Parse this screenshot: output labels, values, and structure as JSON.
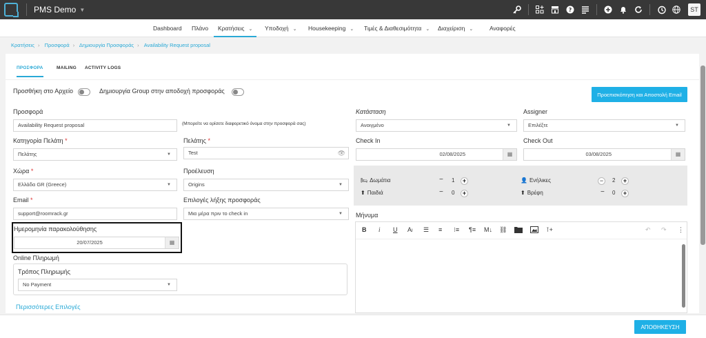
{
  "app": {
    "name": "PMS Demo",
    "user_initials": "ST"
  },
  "topbar": {
    "icons": [
      "key-icon",
      "grid-add-icon",
      "store-icon",
      "help-icon",
      "list-icon",
      "add-circle-icon",
      "bell-icon",
      "refresh-icon",
      "history-icon",
      "globe-icon"
    ]
  },
  "nav": {
    "items": [
      {
        "label": "Dashboard",
        "dropdown": false
      },
      {
        "label": "Πλάνο",
        "dropdown": false
      },
      {
        "label": "Κρατήσεις",
        "dropdown": true,
        "active": true
      },
      {
        "label": "Υποδοχή",
        "dropdown": true
      },
      {
        "label": "Housekeeping",
        "dropdown": true
      },
      {
        "label": "Τιμές & Διαθεσιμότητα",
        "dropdown": true
      },
      {
        "label": "Διαχείριση",
        "dropdown": true
      },
      {
        "label": "Αναφορές",
        "dropdown": false
      }
    ]
  },
  "breadcrumb": [
    "Κρατήσεις",
    "Προσφορά",
    "Δημιουργία Προσφοράς",
    "Availability Request proposal"
  ],
  "tabs": [
    "ΠΡΟΣΦΟΡΑ",
    "MAILING",
    "ACTIVITY LOGS"
  ],
  "toggles": {
    "archive_label": "Προσθήκη στο Αρχείο",
    "group_label": "Δημιουργία Group στην αποδοχή προσφοράς"
  },
  "preview_button": "Προεπισκόπηση και Αποστολή Email",
  "form": {
    "offer_label": "Προσφορά",
    "offer_value": "Availability Request proposal",
    "offer_hint": "(Μπορείτε να ορίσετε διαφορετικό όνομα στην προσφορά σας)",
    "client_category_label": "Κατηγορία Πελάτη",
    "client_category_value": "Πελάτης",
    "client_label": "Πελάτης",
    "client_value": "Test",
    "country_label": "Χώρα",
    "country_value": "Ελλάδα GR (Greece)",
    "origin_label": "Προέλευση",
    "origin_value": "Origins",
    "email_label": "Email",
    "email_value": "support@roomrack.gr",
    "expiry_label": "Επιλογές λήξης προσφοράς",
    "expiry_value": "Μια μέρα πριν το check in",
    "followup_label": "Ημερομηνία παρακολούθησης",
    "followup_value": "20/07/2025",
    "online_payment_label": "Online Πληρωμή",
    "payment_method_label": "Τρόπος Πληρωμής",
    "payment_method_value": "No Payment",
    "more_options": "Περισσότερες Επιλογές",
    "status_label": "Κατάσταση",
    "status_value": "Ανοιγμένο",
    "assigner_label": "Assigner",
    "assigner_value": "Επιλέξτε",
    "checkin_label": "Check In",
    "checkin_value": "02/08/2025",
    "checkout_label": "Check Out",
    "checkout_value": "03/08/2025",
    "message_label": "Μήνυμα"
  },
  "guests": {
    "rooms_label": "Δωμάτια",
    "rooms_value": "1",
    "children_label": "Παιδιά",
    "children_value": "0",
    "adults_label": "Ενήλικες",
    "adults_value": "2",
    "infants_label": "Βρέφη",
    "infants_value": "0"
  },
  "editor_tools": [
    "bold-icon",
    "italic-icon",
    "underline-icon",
    "font-size-icon",
    "align-left-icon",
    "align-center-icon",
    "list-ordered-icon",
    "paragraph-icon",
    "markdown-icon",
    "link-icon",
    "folder-icon",
    "image-icon",
    "insert-icon",
    "undo-icon",
    "redo-icon",
    "more-icon"
  ],
  "save_button": "ΑΠΟΘΗΚΕΥΣΗ",
  "colors": {
    "accent": "#29a9d6",
    "button": "#1fb0e6",
    "topbar": "#383838"
  }
}
